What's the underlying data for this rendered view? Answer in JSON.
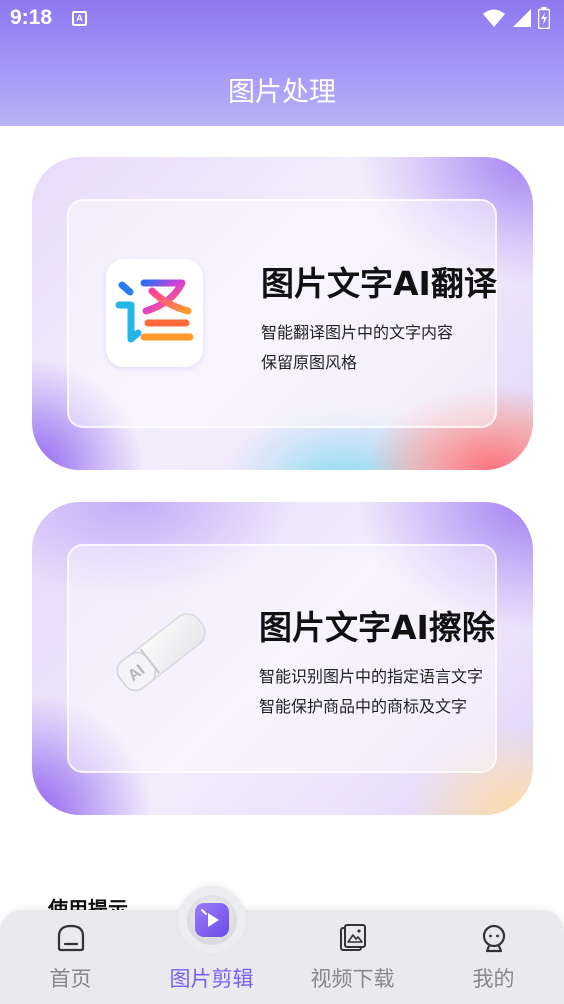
{
  "status_bar": {
    "time": "9:18",
    "a_label": "A"
  },
  "header": {
    "title": "图片处理"
  },
  "cards": [
    {
      "title": "图片文字AI翻译",
      "lines": [
        "智能翻译图片中的文字内容",
        "保留原图风格"
      ],
      "icon": "translate-icon",
      "icon_char": "译"
    },
    {
      "title": "图片文字AI擦除",
      "lines": [
        "智能识别图片中的指定语言文字",
        "智能保护商品中的商标及文字"
      ],
      "icon": "eraser-icon",
      "icon_text": "AI"
    }
  ],
  "usage_hint": "使用提示",
  "tabs": [
    {
      "label": "首页",
      "icon": "home-icon",
      "active": false
    },
    {
      "label": "图片剪辑",
      "icon": "image-edit-icon",
      "active": true
    },
    {
      "label": "视频下载",
      "icon": "video-download-icon",
      "active": false
    },
    {
      "label": "我的",
      "icon": "profile-icon",
      "active": false
    }
  ],
  "colors": {
    "accent": "#7b5ef2",
    "header_top": "#8d77f0",
    "tab_inactive": "#888888"
  }
}
